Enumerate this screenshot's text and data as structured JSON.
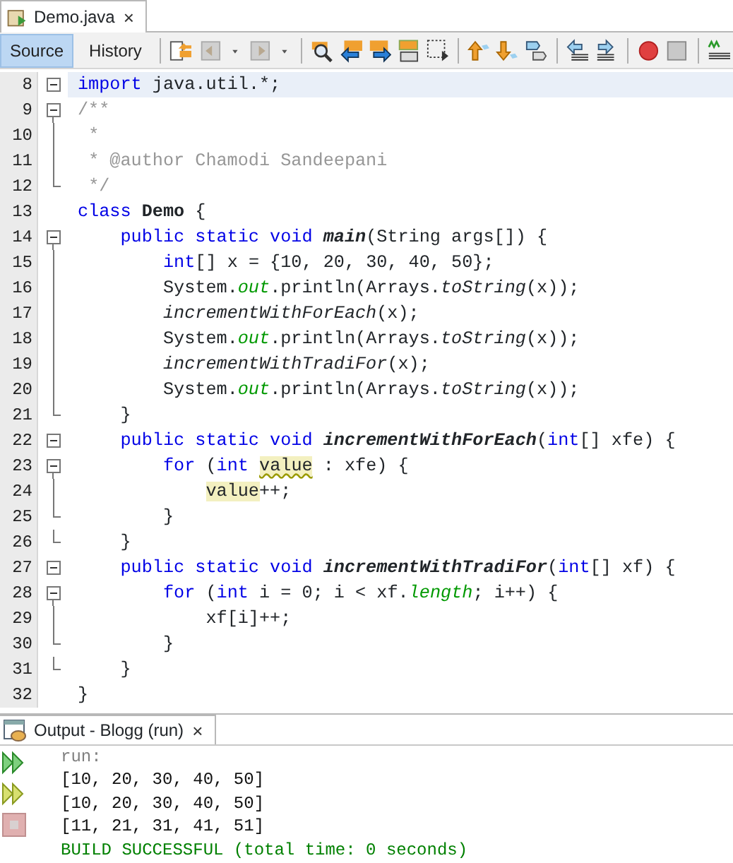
{
  "file_tab": {
    "title": "Demo.java",
    "close": "×"
  },
  "view_tabs": [
    {
      "label": "Source",
      "selected": true
    },
    {
      "label": "History",
      "selected": false
    }
  ],
  "code_lines": [
    {
      "number": "8",
      "collapsible": true,
      "in_fold": false,
      "fold_end": false,
      "current": true,
      "tokens": [
        {
          "kind": "keyword",
          "text": "import"
        },
        {
          "kind": "plain",
          "text": " java.util.*;"
        }
      ]
    },
    {
      "number": "9",
      "collapsible": true,
      "in_fold": false,
      "fold_end": false,
      "current": false,
      "tokens": [
        {
          "kind": "comment",
          "text": "/**"
        }
      ]
    },
    {
      "number": "10",
      "collapsible": false,
      "in_fold": true,
      "fold_end": false,
      "current": false,
      "tokens": [
        {
          "kind": "comment",
          "text": " *"
        }
      ]
    },
    {
      "number": "11",
      "collapsible": false,
      "in_fold": true,
      "fold_end": false,
      "current": false,
      "tokens": [
        {
          "kind": "comment",
          "text": " * @author Chamodi Sandeepani"
        }
      ]
    },
    {
      "number": "12",
      "collapsible": false,
      "in_fold": false,
      "fold_end": true,
      "current": false,
      "tokens": [
        {
          "kind": "comment",
          "text": " */"
        }
      ]
    },
    {
      "number": "13",
      "collapsible": false,
      "in_fold": false,
      "fold_end": false,
      "current": false,
      "tokens": [
        {
          "kind": "keyword",
          "text": "class "
        },
        {
          "kind": "bold",
          "text": "Demo"
        },
        {
          "kind": "plain",
          "text": " {"
        }
      ]
    },
    {
      "number": "14",
      "collapsible": true,
      "in_fold": false,
      "fold_end": false,
      "current": false,
      "tokens": [
        {
          "kind": "keyword",
          "text": "    public static void "
        },
        {
          "kind": "declaration",
          "text": "main"
        },
        {
          "kind": "plain",
          "text": "(String args[]) {"
        }
      ]
    },
    {
      "number": "15",
      "collapsible": false,
      "in_fold": true,
      "fold_end": false,
      "current": false,
      "tokens": [
        {
          "kind": "keyword",
          "text": "        int"
        },
        {
          "kind": "plain",
          "text": "[] x = {10, 20, 30, 40, 50};"
        }
      ]
    },
    {
      "number": "16",
      "collapsible": false,
      "in_fold": true,
      "fold_end": false,
      "current": false,
      "tokens": [
        {
          "kind": "plain",
          "text": "        System."
        },
        {
          "kind": "field",
          "text": "out"
        },
        {
          "kind": "plain",
          "text": ".println(Arrays."
        },
        {
          "kind": "static",
          "text": "toString"
        },
        {
          "kind": "plain",
          "text": "(x));"
        }
      ]
    },
    {
      "number": "17",
      "collapsible": false,
      "in_fold": true,
      "fold_end": false,
      "current": false,
      "tokens": [
        {
          "kind": "static",
          "text": "        incrementWithForEach"
        },
        {
          "kind": "plain",
          "text": "(x);"
        }
      ]
    },
    {
      "number": "18",
      "collapsible": false,
      "in_fold": true,
      "fold_end": false,
      "current": false,
      "tokens": [
        {
          "kind": "plain",
          "text": "        System."
        },
        {
          "kind": "field",
          "text": "out"
        },
        {
          "kind": "plain",
          "text": ".println(Arrays."
        },
        {
          "kind": "static",
          "text": "toString"
        },
        {
          "kind": "plain",
          "text": "(x));"
        }
      ]
    },
    {
      "number": "19",
      "collapsible": false,
      "in_fold": true,
      "fold_end": false,
      "current": false,
      "tokens": [
        {
          "kind": "static",
          "text": "        incrementWithTradiFor"
        },
        {
          "kind": "plain",
          "text": "(x);"
        }
      ]
    },
    {
      "number": "20",
      "collapsible": false,
      "in_fold": true,
      "fold_end": false,
      "current": false,
      "tokens": [
        {
          "kind": "plain",
          "text": "        System."
        },
        {
          "kind": "field",
          "text": "out"
        },
        {
          "kind": "plain",
          "text": ".println(Arrays."
        },
        {
          "kind": "static",
          "text": "toString"
        },
        {
          "kind": "plain",
          "text": "(x));"
        }
      ]
    },
    {
      "number": "21",
      "collapsible": false,
      "in_fold": false,
      "fold_end": true,
      "current": false,
      "tokens": [
        {
          "kind": "plain",
          "text": "    }"
        }
      ]
    },
    {
      "number": "22",
      "collapsible": true,
      "in_fold": false,
      "fold_end": false,
      "current": false,
      "tokens": [
        {
          "kind": "keyword",
          "text": "    public static void "
        },
        {
          "kind": "declaration",
          "text": "incrementWithForEach"
        },
        {
          "kind": "plain",
          "text": "("
        },
        {
          "kind": "keyword",
          "text": "int"
        },
        {
          "kind": "plain",
          "text": "[] xfe) {"
        }
      ]
    },
    {
      "number": "23",
      "collapsible": true,
      "in_fold": false,
      "fold_end": false,
      "current": false,
      "tokens": [
        {
          "kind": "keyword",
          "text": "        for"
        },
        {
          "kind": "plain",
          "text": " ("
        },
        {
          "kind": "keyword",
          "text": "int "
        },
        {
          "kind": "warning",
          "text": "value"
        },
        {
          "kind": "plain",
          "text": " : xfe) {"
        }
      ]
    },
    {
      "number": "24",
      "collapsible": false,
      "in_fold": true,
      "fold_end": false,
      "current": false,
      "tokens": [
        {
          "kind": "marked",
          "text": "            value"
        },
        {
          "kind": "plain",
          "text": "++;"
        }
      ]
    },
    {
      "number": "25",
      "collapsible": false,
      "in_fold": false,
      "fold_end": true,
      "current": false,
      "tokens": [
        {
          "kind": "plain",
          "text": "        }"
        }
      ]
    },
    {
      "number": "26",
      "collapsible": false,
      "in_fold": false,
      "fold_end": true,
      "current": false,
      "tokens": [
        {
          "kind": "plain",
          "text": "    }"
        }
      ]
    },
    {
      "number": "27",
      "collapsible": true,
      "in_fold": false,
      "fold_end": false,
      "current": false,
      "tokens": [
        {
          "kind": "keyword",
          "text": "    public static void "
        },
        {
          "kind": "declaration",
          "text": "incrementWithTradiFor"
        },
        {
          "kind": "plain",
          "text": "("
        },
        {
          "kind": "keyword",
          "text": "int"
        },
        {
          "kind": "plain",
          "text": "[] xf) {"
        }
      ]
    },
    {
      "number": "28",
      "collapsible": true,
      "in_fold": false,
      "fold_end": false,
      "current": false,
      "tokens": [
        {
          "kind": "keyword",
          "text": "        for"
        },
        {
          "kind": "plain",
          "text": " ("
        },
        {
          "kind": "keyword",
          "text": "int"
        },
        {
          "kind": "plain",
          "text": " i = 0; i < xf."
        },
        {
          "kind": "field",
          "text": "length"
        },
        {
          "kind": "plain",
          "text": "; i++) {"
        }
      ]
    },
    {
      "number": "29",
      "collapsible": false,
      "in_fold": true,
      "fold_end": false,
      "current": false,
      "tokens": [
        {
          "kind": "plain",
          "text": "            xf[i]++;"
        }
      ]
    },
    {
      "number": "30",
      "collapsible": false,
      "in_fold": false,
      "fold_end": true,
      "current": false,
      "tokens": [
        {
          "kind": "plain",
          "text": "        }"
        }
      ]
    },
    {
      "number": "31",
      "collapsible": false,
      "in_fold": false,
      "fold_end": true,
      "current": false,
      "tokens": [
        {
          "kind": "plain",
          "text": "    }"
        }
      ]
    },
    {
      "number": "32",
      "collapsible": false,
      "in_fold": false,
      "fold_end": false,
      "current": false,
      "tokens": [
        {
          "kind": "plain",
          "text": "}"
        }
      ]
    }
  ],
  "output_tab": {
    "title": "Output - Blogg (run)",
    "close": "×"
  },
  "output_lines": [
    {
      "kind": "info",
      "text": "run:"
    },
    {
      "kind": "normal",
      "text": "[10, 20, 30, 40, 50]"
    },
    {
      "kind": "normal",
      "text": "[10, 20, 30, 40, 50]"
    },
    {
      "kind": "normal",
      "text": "[11, 21, 31, 41, 51]"
    },
    {
      "kind": "success",
      "text": "BUILD SUCCESSFUL (total time: 0 seconds)"
    }
  ]
}
